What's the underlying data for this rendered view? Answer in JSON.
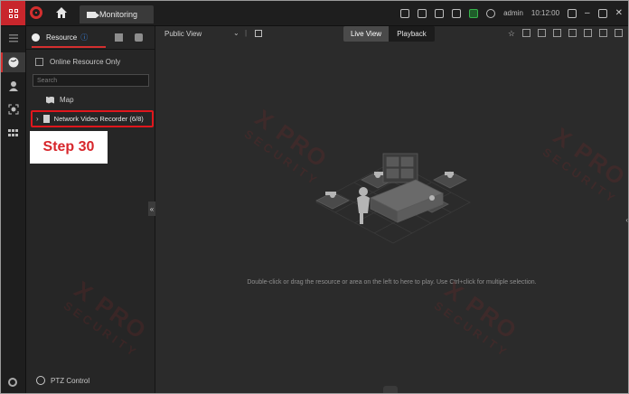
{
  "titlebar": {
    "tab_label": "Monitoring",
    "user": "admin",
    "time": "10:12:00"
  },
  "panel": {
    "tab_resource": "Resource",
    "info_mark": "ⓘ",
    "online_only": "Online Resource Only",
    "search_placeholder": "Search",
    "tree": {
      "map_label": "Map",
      "nvr_label": "Network Video Recorder (6/8)"
    },
    "ptz_label": "PTZ Control",
    "collapse_glyph": "«"
  },
  "step_label": "Step 30",
  "main": {
    "view_name": "Public View",
    "live_view": "Live View",
    "playback": "Playback",
    "hint": "Double-click or drag the resource or area on the left to here to play. Use Ctrl+click for multiple selection."
  },
  "watermark": {
    "brand": "X PRO",
    "sub": "SECURITY"
  },
  "colors": {
    "accent": "#d32f2f",
    "highlight_border": "#e0161c",
    "step_text": "#d7262b",
    "info": "#3b8cf5"
  }
}
